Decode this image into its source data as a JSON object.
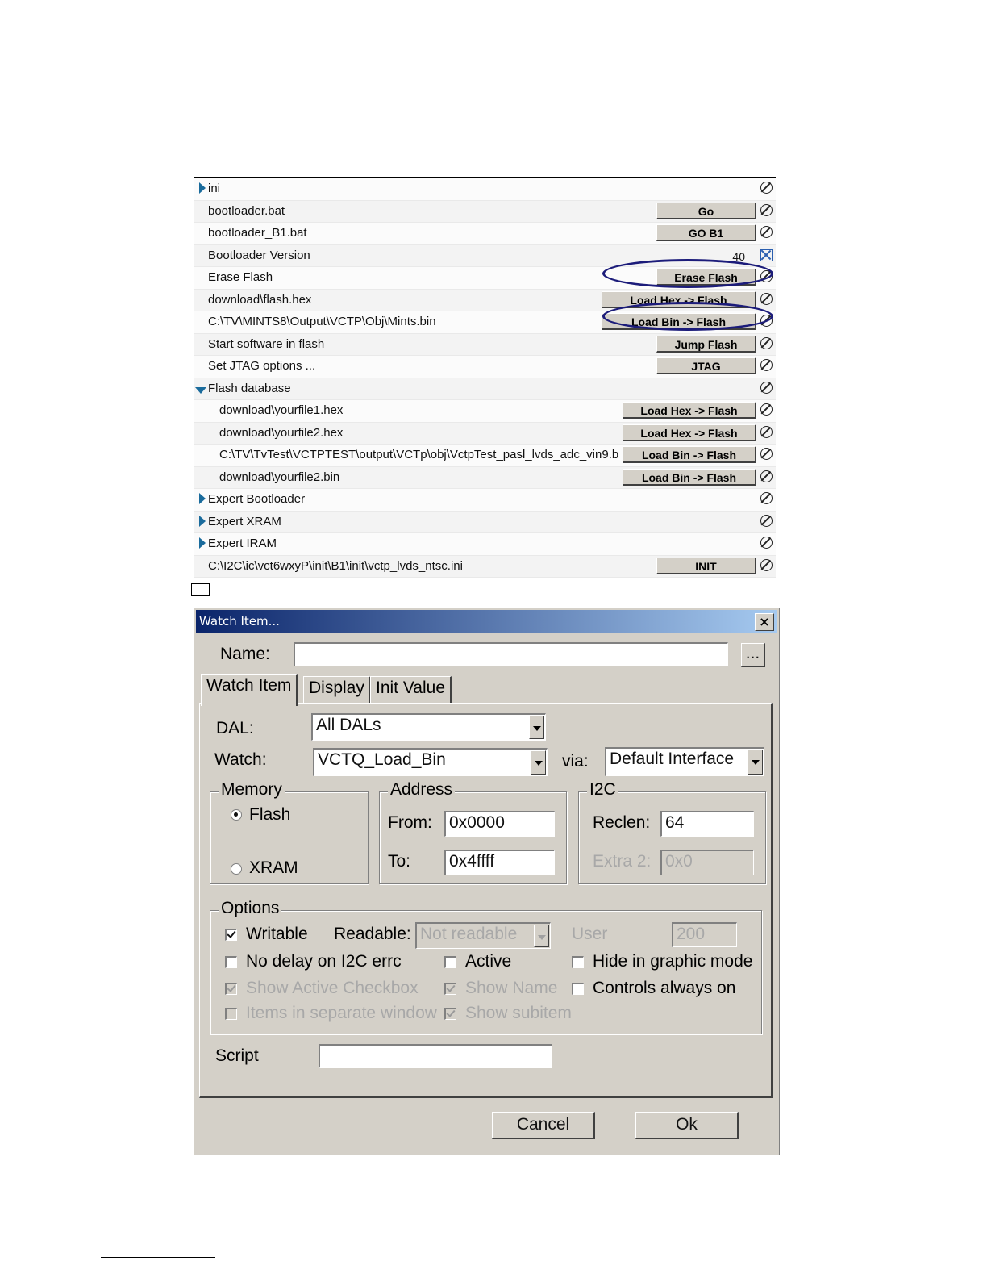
{
  "property_list": {
    "rows": [
      {
        "label": "ini",
        "button": "",
        "value": "",
        "expander": "right",
        "indent": 0,
        "icon": "null-icon"
      },
      {
        "label": "bootloader.bat",
        "button": "Go",
        "value": "",
        "expander": "",
        "indent": 0,
        "icon": "null-icon"
      },
      {
        "label": "bootloader_B1.bat",
        "button": "GO B1",
        "value": "",
        "expander": "",
        "indent": 0,
        "icon": "null-icon"
      },
      {
        "label": "Bootloader Version",
        "button": "",
        "value": "40",
        "expander": "",
        "indent": 0,
        "icon": "checked-box-icon"
      },
      {
        "label": "Erase Flash",
        "button": "Erase Flash",
        "value": "",
        "expander": "",
        "indent": 0,
        "icon": "null-icon"
      },
      {
        "label": "download\\flash.hex",
        "button": "Load Hex -> Flash",
        "value": "",
        "expander": "",
        "indent": 0,
        "icon": "null-icon"
      },
      {
        "label": "C:\\TV\\MINTS8\\Output\\VCTP\\Obj\\Mints.bin",
        "button": "Load Bin -> Flash",
        "value": "",
        "expander": "",
        "indent": 0,
        "icon": "null-icon"
      },
      {
        "label": "Start software in flash",
        "button": "Jump Flash",
        "value": "",
        "expander": "",
        "indent": 0,
        "icon": "null-icon"
      },
      {
        "label": "Set JTAG options ...",
        "button": "JTAG",
        "value": "",
        "expander": "",
        "indent": 0,
        "icon": "null-icon"
      },
      {
        "label": "Flash database",
        "button": "",
        "value": "",
        "expander": "down",
        "indent": 0,
        "icon": "null-icon"
      },
      {
        "label": "download\\yourfile1.hex",
        "button": "Load Hex -> Flash",
        "value": "",
        "expander": "",
        "indent": 1,
        "icon": "null-icon"
      },
      {
        "label": "download\\yourfile2.hex",
        "button": "Load Hex -> Flash",
        "value": "",
        "expander": "",
        "indent": 1,
        "icon": "null-icon"
      },
      {
        "label": "C:\\TV\\TvTest\\VCTPTEST\\output\\VCTp\\obj\\VctpTest_pasl_lvds_adc_vin9.b",
        "button": "Load Bin -> Flash",
        "value": "",
        "expander": "",
        "indent": 1,
        "icon": "null-icon"
      },
      {
        "label": "download\\yourfile2.bin",
        "button": "Load Bin -> Flash",
        "value": "",
        "expander": "",
        "indent": 1,
        "icon": "null-icon"
      },
      {
        "label": "Expert Bootloader",
        "button": "",
        "value": "",
        "expander": "right",
        "indent": 0,
        "icon": "null-icon"
      },
      {
        "label": "Expert XRAM",
        "button": "",
        "value": "",
        "expander": "right",
        "indent": 0,
        "icon": "null-icon"
      },
      {
        "label": "Expert IRAM",
        "button": "",
        "value": "",
        "expander": "right",
        "indent": 0,
        "icon": "null-icon"
      },
      {
        "label": "C:\\I2C\\ic\\vct6wxyP\\init\\B1\\init\\vctp_lvds_ntsc.ini",
        "button": "INIT",
        "value": "",
        "expander": "",
        "indent": 0,
        "icon": "null-icon"
      }
    ]
  },
  "dialog": {
    "title": "Watch Item...",
    "close_label": "×",
    "name_label": "Name:",
    "name_value": "",
    "browse_label": "...",
    "tabs": [
      "Watch Item",
      "Display",
      "Init Value"
    ],
    "dal_label": "DAL:",
    "dal_value": "All DALs",
    "watch_label": "Watch:",
    "watch_value": "VCTQ_Load_Bin",
    "via_label": "via:",
    "via_value": "Default Interface",
    "memory": {
      "title": "Memory",
      "flash_label": "Flash",
      "xram_label": "XRAM",
      "selected": "Flash"
    },
    "address": {
      "title": "Address",
      "from_label": "From:",
      "from_value": "0x0000",
      "to_label": "To:",
      "to_value": "0x4ffff"
    },
    "i2c": {
      "title": "I2C",
      "reclen_label": "Reclen:",
      "reclen_value": "64",
      "extra2_label": "Extra 2:",
      "extra2_value": "0x0"
    },
    "options": {
      "title": "Options",
      "writable_label": "Writable",
      "readable_label": "Readable:",
      "readable_value": "Not readable",
      "user_label": "User",
      "user_value": "200",
      "no_delay_label": "No delay on I2C errc",
      "active_label": "Active",
      "hide_label": "Hide in graphic mode",
      "show_active_label": "Show Active Checkbox",
      "show_name_label": "Show Name",
      "controls_label": "Controls always on",
      "separate_label": "Items in separate window",
      "show_subitem_label": "Show subitem"
    },
    "script_label": "Script",
    "script_value": "",
    "cancel_label": "Cancel",
    "ok_label": "Ok"
  },
  "colors": {
    "highlight_ellipse": "#1c1c7a",
    "titlebar": "#0a246a",
    "expander": "#1a6b9c"
  }
}
